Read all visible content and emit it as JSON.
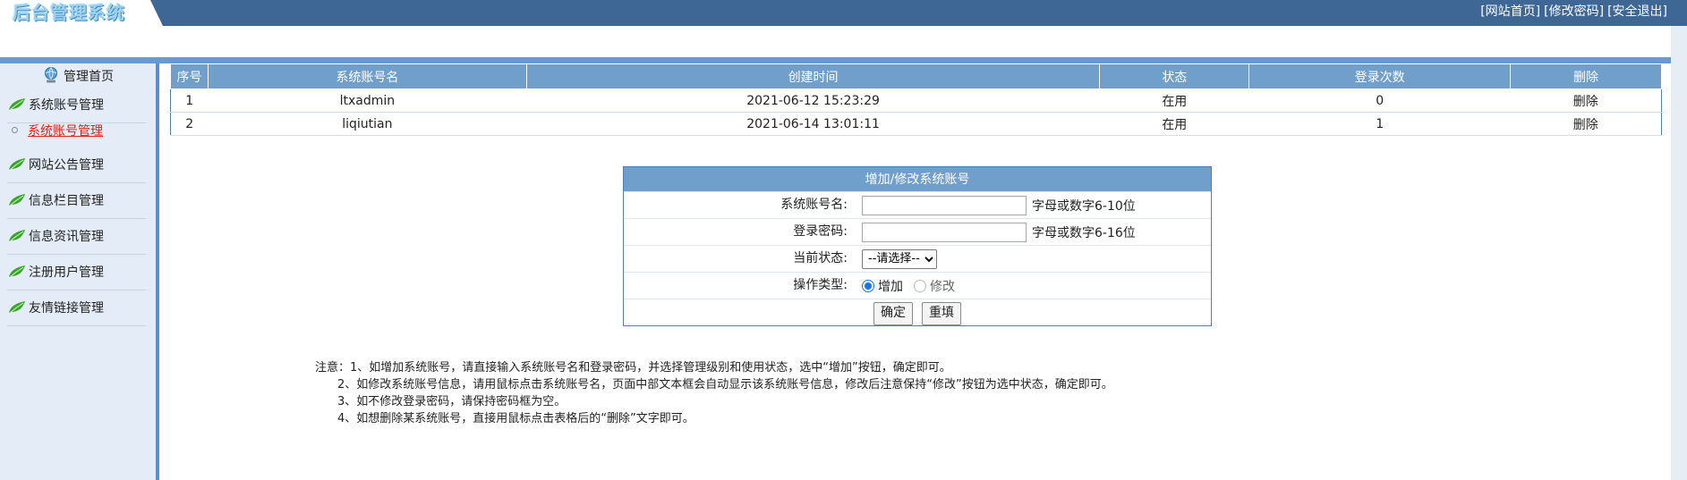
{
  "header": {
    "logo_text": "后台管理系统",
    "links": [
      "[网站首页]",
      "[修改密码]",
      "[安全退出]"
    ]
  },
  "sidebar": {
    "home_label": "管理首页",
    "items": [
      {
        "label": "系统账号管理"
      },
      {
        "label": "网站公告管理"
      },
      {
        "label": "信息栏目管理"
      },
      {
        "label": "信息资讯管理"
      },
      {
        "label": "注册用户管理"
      },
      {
        "label": "友情链接管理"
      }
    ],
    "active_sub": "系统账号管理"
  },
  "table": {
    "headers": [
      "序号",
      "系统账号名",
      "创建时间",
      "状态",
      "登录次数",
      "删除"
    ],
    "rows": [
      {
        "index": "1",
        "account": "ltxadmin",
        "created": "2021-06-12 15:23:29",
        "status": "在用",
        "logins": "0",
        "delete": "删除"
      },
      {
        "index": "2",
        "account": "liqiutian",
        "created": "2021-06-14 13:01:11",
        "status": "在用",
        "logins": "1",
        "delete": "删除"
      }
    ]
  },
  "form": {
    "title": "增加/修改系统账号",
    "account_label": "系统账号名:",
    "account_value": "",
    "account_hint": "字母或数字6-10位",
    "password_label": "登录密码:",
    "password_value": "",
    "password_hint": "字母或数字6-16位",
    "status_label": "当前状态:",
    "status_selected": "--请选择--",
    "op_label": "操作类型:",
    "op_add": "增加",
    "op_edit": "修改",
    "op_selected": "增加",
    "confirm_label": "确定",
    "reset_label": "重填"
  },
  "notes": [
    "注意：1、如增加系统账号，请直接输入系统账号名和登录密码，并选择管理级别和使用状态，选中“增加”按钮，确定即可。",
    "2、如修改系统账号信息，请用鼠标点击系统账号名，页面中部文本框会自动显示该系统账号信息，修改后注意保持“修改”按钮为选中状态，确定即可。",
    "3、如不修改登录密码，请保持密码框为空。",
    "4、如想删除某系统账号，直接用鼠标点击表格后的“删除”文字即可。"
  ],
  "colors": {
    "header_bg": "#3e6795",
    "accent_blue": "#6f9fca",
    "sidebar_bg": "#e3ecf7",
    "active_link": "#e0221a",
    "leaf_green": "#3aa32a"
  }
}
